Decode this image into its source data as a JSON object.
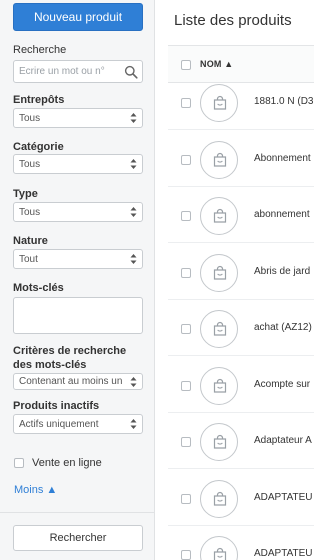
{
  "sidebar": {
    "new_product_button": "Nouveau produit",
    "search": {
      "label": "Recherche",
      "placeholder": "Ecrire un mot ou n°"
    },
    "warehouses": {
      "label": "Entrepôts",
      "value": "Tous"
    },
    "category": {
      "label": "Catégorie",
      "value": "Tous"
    },
    "type": {
      "label": "Type",
      "value": "Tous"
    },
    "nature": {
      "label": "Nature",
      "value": "Tout"
    },
    "keywords": {
      "label": "Mots-clés"
    },
    "keyword_criteria": {
      "label_line1": "Critères de recherche",
      "label_line2": "des mots-clés",
      "value": "Contenant au moins un"
    },
    "inactive_products": {
      "label": "Produits inactifs",
      "value": "Actifs uniquement"
    },
    "online_sale": {
      "label": "Vente en ligne"
    },
    "less_link": "Moins ▲",
    "search_button": "Rechercher"
  },
  "main": {
    "title": "Liste des produits",
    "column_header": "NOM ▲",
    "rows": [
      {
        "name": "1881.0 N (D3"
      },
      {
        "name": "Abonnement"
      },
      {
        "name": "abonnement"
      },
      {
        "name": "Abris de jard"
      },
      {
        "name": "achat (AZ12)"
      },
      {
        "name": "Acompte sur"
      },
      {
        "name": "Adaptateur A"
      },
      {
        "name": "ADAPTATEU"
      },
      {
        "name": "ADAPTATEU"
      }
    ]
  },
  "icons": {
    "search": "search-icon",
    "select_arrows": "up-down-arrows-icon",
    "product": "shopping-bag-icon"
  },
  "colors": {
    "accent": "#2f7fd6",
    "sidebar_bg": "#f5f6f7"
  }
}
